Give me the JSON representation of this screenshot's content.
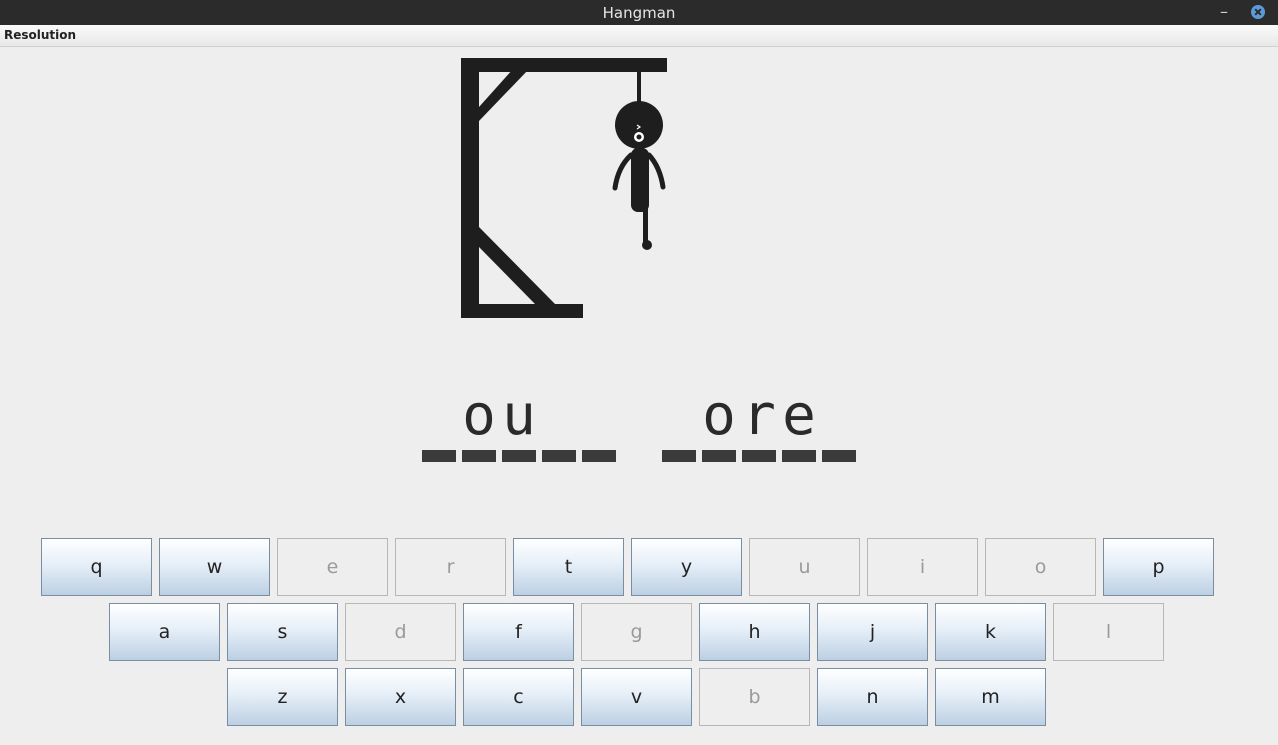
{
  "window": {
    "title": "Hangman"
  },
  "menu": {
    "items": [
      "Resolution"
    ]
  },
  "puzzle": {
    "words": [
      [
        "",
        "o",
        "u",
        "",
        ""
      ],
      [
        "",
        "o",
        "r",
        "e",
        ""
      ]
    ]
  },
  "keyboard": {
    "rows": [
      [
        {
          "letter": "q",
          "enabled": true
        },
        {
          "letter": "w",
          "enabled": true
        },
        {
          "letter": "e",
          "enabled": false
        },
        {
          "letter": "r",
          "enabled": false
        },
        {
          "letter": "t",
          "enabled": true
        },
        {
          "letter": "y",
          "enabled": true
        },
        {
          "letter": "u",
          "enabled": false
        },
        {
          "letter": "i",
          "enabled": false
        },
        {
          "letter": "o",
          "enabled": false
        },
        {
          "letter": "p",
          "enabled": true
        }
      ],
      [
        {
          "letter": "a",
          "enabled": true
        },
        {
          "letter": "s",
          "enabled": true
        },
        {
          "letter": "d",
          "enabled": false
        },
        {
          "letter": "f",
          "enabled": true
        },
        {
          "letter": "g",
          "enabled": false
        },
        {
          "letter": "h",
          "enabled": true
        },
        {
          "letter": "j",
          "enabled": true
        },
        {
          "letter": "k",
          "enabled": true
        },
        {
          "letter": "l",
          "enabled": false
        }
      ],
      [
        {
          "letter": "z",
          "enabled": true
        },
        {
          "letter": "x",
          "enabled": true
        },
        {
          "letter": "c",
          "enabled": true
        },
        {
          "letter": "v",
          "enabled": true
        },
        {
          "letter": "b",
          "enabled": false
        },
        {
          "letter": "n",
          "enabled": true
        },
        {
          "letter": "m",
          "enabled": true
        }
      ]
    ]
  },
  "colors": {
    "titlebar": "#2b2b2b",
    "close_button": "#5a9bd8",
    "key_enabled_top": "#ffffff",
    "key_enabled_bottom": "#bcd0e3",
    "key_disabled_text": "#9a9a9a",
    "gallows": "#1e1e1e"
  }
}
